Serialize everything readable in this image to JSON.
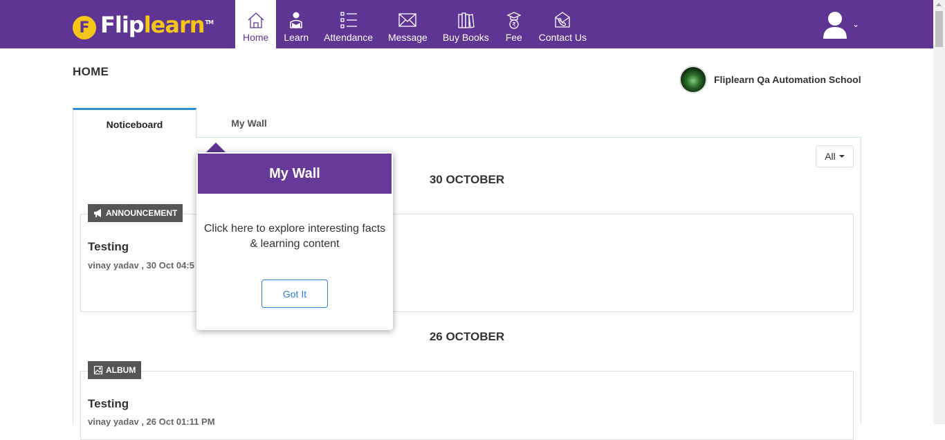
{
  "brand": {
    "logo_letter": "F",
    "name_white": "Flip",
    "name_yellow": "learn",
    "tm": "TM"
  },
  "nav": [
    {
      "label": "Home",
      "icon": "home-icon",
      "active": true
    },
    {
      "label": "Learn",
      "icon": "learn-icon"
    },
    {
      "label": "Attendance",
      "icon": "attendance-icon"
    },
    {
      "label": "Message",
      "icon": "message-icon"
    },
    {
      "label": "Buy Books",
      "icon": "books-icon"
    },
    {
      "label": "Fee",
      "icon": "fee-icon"
    },
    {
      "label": "Contact Us",
      "icon": "contact-icon"
    }
  ],
  "page": {
    "title": "HOME",
    "school_name": "Fliplearn Qa Automation School"
  },
  "tabs": {
    "noticeboard": "Noticeboard",
    "mywall": "My Wall"
  },
  "filter": {
    "selected": "All"
  },
  "feed": [
    {
      "date": "30 OCTOBER",
      "type": "ANNOUNCEMENT",
      "title": "Testing",
      "meta": "vinay yadav , 30 Oct 04:5"
    },
    {
      "date": "26 OCTOBER",
      "type": "ALBUM",
      "title": "Testing",
      "meta": "vinay yadav , 26 Oct 01:11 PM"
    }
  ],
  "popover": {
    "title": "My Wall",
    "body": "Click here to explore interesting facts & learning content",
    "button": "Got It"
  },
  "colors": {
    "header": "#5e3592",
    "accent_yellow": "#f5c518",
    "tab_accent": "#2a8fd4"
  }
}
